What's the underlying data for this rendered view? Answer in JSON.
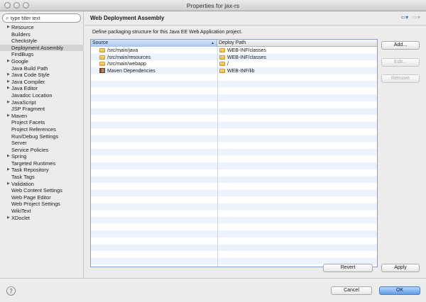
{
  "window": {
    "title": "Properties for jax-rs"
  },
  "sidebar": {
    "filter_placeholder": "type filter text",
    "items": [
      {
        "label": "Resource",
        "expandable": true
      },
      {
        "label": "Builders",
        "expandable": false
      },
      {
        "label": "Checkstyle",
        "expandable": false
      },
      {
        "label": "Deployment Assembly",
        "expandable": false,
        "selected": true
      },
      {
        "label": "FindBugs",
        "expandable": false
      },
      {
        "label": "Google",
        "expandable": true
      },
      {
        "label": "Java Build Path",
        "expandable": false
      },
      {
        "label": "Java Code Style",
        "expandable": true
      },
      {
        "label": "Java Compiler",
        "expandable": true
      },
      {
        "label": "Java Editor",
        "expandable": true
      },
      {
        "label": "Javadoc Location",
        "expandable": false
      },
      {
        "label": "JavaScript",
        "expandable": true
      },
      {
        "label": "JSP Fragment",
        "expandable": false
      },
      {
        "label": "Maven",
        "expandable": true
      },
      {
        "label": "Project Facets",
        "expandable": false
      },
      {
        "label": "Project References",
        "expandable": false
      },
      {
        "label": "Run/Debug Settings",
        "expandable": false
      },
      {
        "label": "Server",
        "expandable": false
      },
      {
        "label": "Service Policies",
        "expandable": false
      },
      {
        "label": "Spring",
        "expandable": true
      },
      {
        "label": "Targeted Runtimes",
        "expandable": false
      },
      {
        "label": "Task Repository",
        "expandable": true
      },
      {
        "label": "Task Tags",
        "expandable": false
      },
      {
        "label": "Validation",
        "expandable": true
      },
      {
        "label": "Web Content Settings",
        "expandable": false
      },
      {
        "label": "Web Page Editor",
        "expandable": false
      },
      {
        "label": "Web Project Settings",
        "expandable": false
      },
      {
        "label": "WikiText",
        "expandable": false
      },
      {
        "label": "XDoclet",
        "expandable": true
      }
    ]
  },
  "main": {
    "title": "Web Deployment Assembly",
    "description": "Define packaging structure for this Java EE Web Application project.",
    "table": {
      "columns": [
        "Source",
        "Deploy Path"
      ],
      "rows": [
        {
          "source": "/src/main/java",
          "deploy_path": "WEB-INF/classes",
          "icon": "folder-icon"
        },
        {
          "source": "/src/main/resources",
          "deploy_path": "WEB-INF/classes",
          "icon": "folder-icon"
        },
        {
          "source": "/src/main/webapp",
          "deploy_path": "/",
          "icon": "folder-icon"
        },
        {
          "source": "Maven Dependencies",
          "deploy_path": "WEB-INF/lib",
          "icon": "library-icon"
        }
      ]
    },
    "buttons": {
      "add": "Add...",
      "edit": "Edit...",
      "remove": "Remove",
      "revert": "Revert",
      "apply": "Apply"
    }
  },
  "footer": {
    "help": "?",
    "cancel": "Cancel",
    "ok": "OK"
  },
  "colors": {
    "accent": "#5f9de8",
    "selection": "#d3d3d3",
    "row_alt": "#edf3fe"
  }
}
